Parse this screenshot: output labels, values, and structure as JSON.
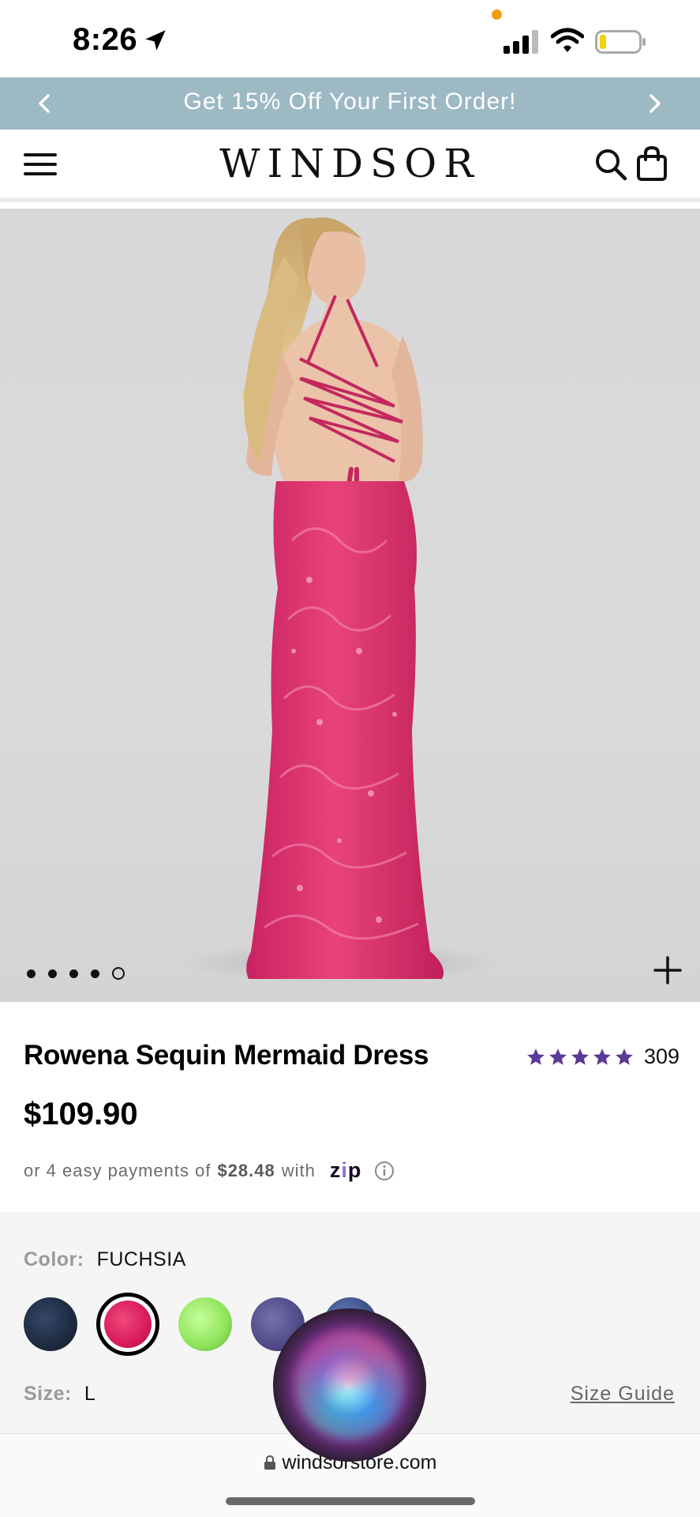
{
  "status_bar": {
    "time": "8:26"
  },
  "promo": {
    "text": "Get 15% Off Your First Order!"
  },
  "header": {
    "logo": "WINDSOR"
  },
  "gallery": {
    "dot_count": 5,
    "active_index": 4
  },
  "product": {
    "title": "Rowena Sequin Mermaid Dress",
    "rating": 5,
    "review_count": "309",
    "price": "$109.90",
    "payments_prefix": "or 4 easy payments of",
    "payments_amount": "$28.48",
    "payments_suffix": "with",
    "payments_provider": "zip"
  },
  "options": {
    "color_label": "Color:",
    "color_value": "FUCHSIA",
    "swatches": [
      {
        "name": "navy",
        "color": "#1d2a3f",
        "selected": false
      },
      {
        "name": "fuchsia",
        "color": "#d81b5c",
        "selected": true
      },
      {
        "name": "lime",
        "color": "#8fe35a",
        "selected": false
      },
      {
        "name": "purple",
        "color": "#4f4a86",
        "selected": false
      },
      {
        "name": "blue",
        "color": "#3b4f86",
        "selected": false
      }
    ],
    "size_label": "Size:",
    "size_value": "L",
    "size_guide": "Size Guide"
  },
  "browser": {
    "url": "windsorstore.com"
  },
  "colors": {
    "promo_bg": "#9cb9c4",
    "star": "#5b3a98",
    "dress": "#e0326c"
  }
}
